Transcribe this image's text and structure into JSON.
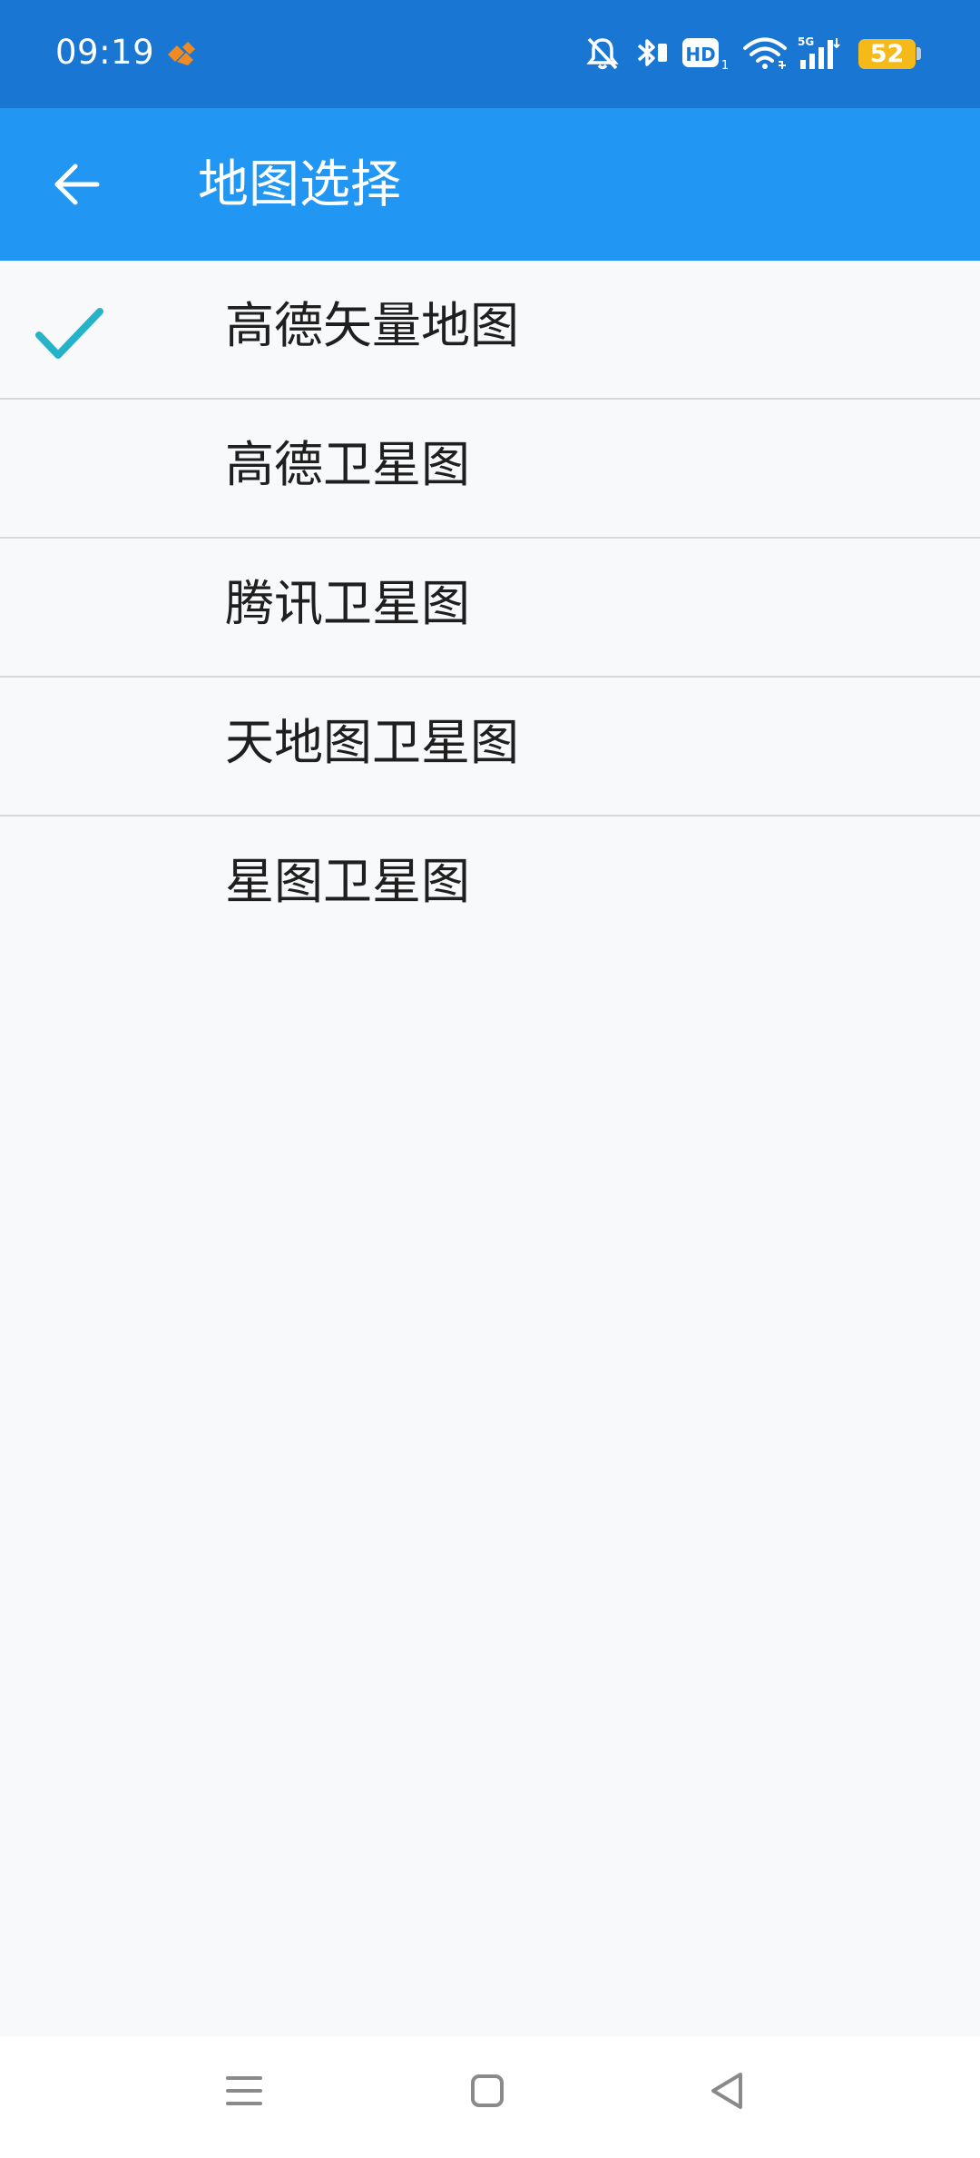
{
  "status_bar": {
    "time": "09:19",
    "battery_level": "52",
    "icons": [
      "app-notification-icon",
      "mute-notification-icon",
      "bluetooth-icon",
      "hd-call-icon",
      "wifi-icon",
      "cellular-5g-signal-icon",
      "battery-icon"
    ],
    "hd_sub": "1",
    "network_type": "5G"
  },
  "app_bar": {
    "title": "地图选择",
    "back_icon": "arrow-left-icon"
  },
  "map_options": [
    {
      "label": "高德矢量地图",
      "selected": true
    },
    {
      "label": "高德卫星图",
      "selected": false
    },
    {
      "label": "腾讯卫星图",
      "selected": false
    },
    {
      "label": "天地图卫星图",
      "selected": false
    },
    {
      "label": "星图卫星图",
      "selected": false
    }
  ],
  "nav_bar": {
    "icons": [
      "menu-icon",
      "home-icon",
      "back-triangle-icon"
    ]
  },
  "colors": {
    "status_bar": "#1976d2",
    "app_bar": "#2196f3",
    "check": "#26b3c9",
    "battery": "#f5b91a",
    "background": "#f8f9fa"
  }
}
